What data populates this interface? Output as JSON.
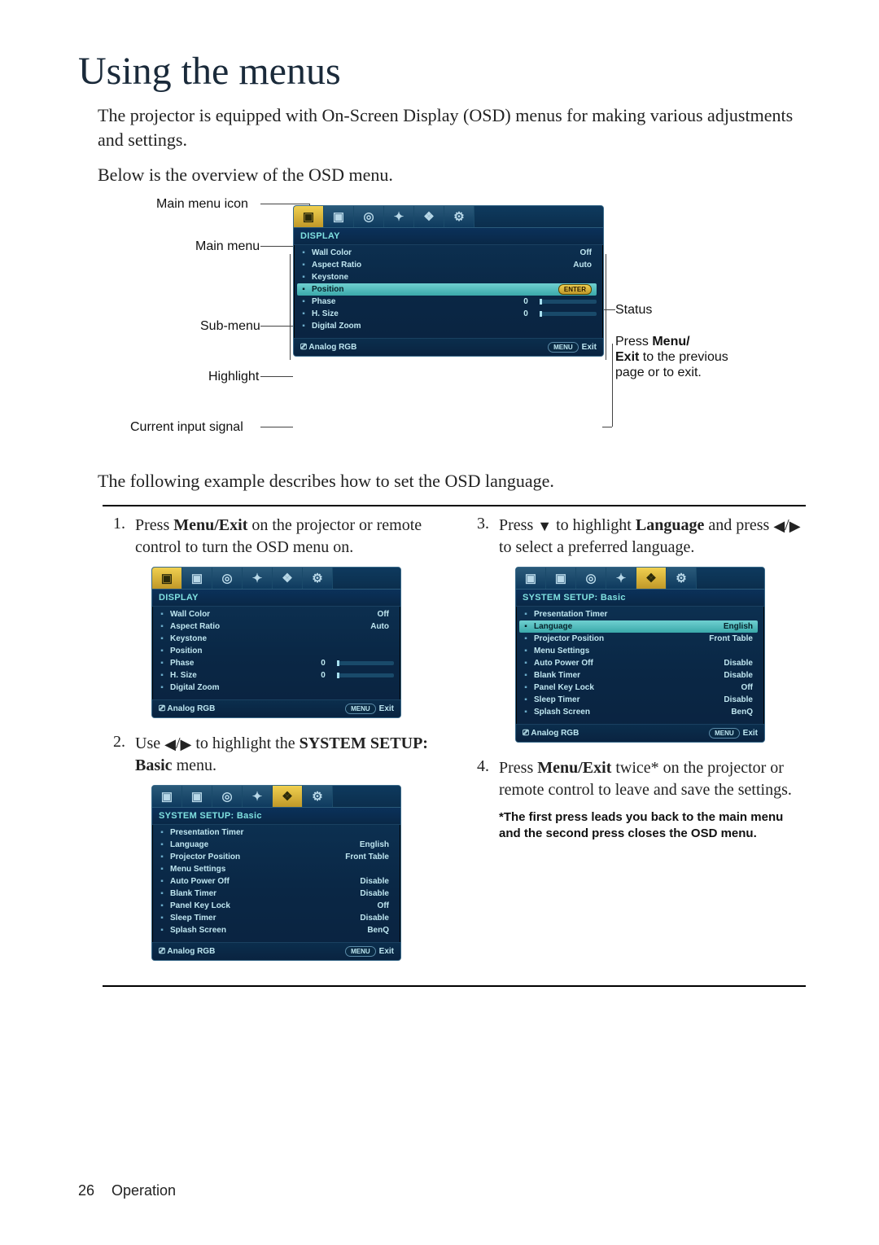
{
  "page": {
    "title": "Using the menus",
    "intro": "The projector is equipped with On-Screen Display (OSD) menus for making various adjustments and settings.",
    "below": "Below is the overview of the OSD menu.",
    "following": "The following example describes how to set the OSD language."
  },
  "diagram": {
    "main_menu_icon": "Main menu icon",
    "main_menu": "Main menu",
    "sub_menu": "Sub-menu",
    "highlight": "Highlight",
    "current_input_signal": "Current input signal",
    "status": "Status",
    "press_menu_exit": "Press Menu/\nExit to the previous page or to exit."
  },
  "osd_common": {
    "footer_input": "Analog RGB",
    "footer_menu": "MENU",
    "footer_exit": "Exit"
  },
  "display_menu": {
    "title": "DISPLAY",
    "rows": [
      {
        "label": "Wall Color",
        "value": "Off"
      },
      {
        "label": "Aspect Ratio",
        "value": "Auto"
      },
      {
        "label": "Keystone",
        "value": ""
      },
      {
        "label": "Position",
        "enter": true,
        "highlight": true
      },
      {
        "label": "Phase",
        "slider": "0"
      },
      {
        "label": "H. Size",
        "slider": "0"
      },
      {
        "label": "Digital Zoom",
        "value": ""
      }
    ]
  },
  "display_menu_small": {
    "title": "DISPLAY",
    "rows": [
      {
        "label": "Wall Color",
        "value": "Off"
      },
      {
        "label": "Aspect Ratio",
        "value": "Auto"
      },
      {
        "label": "Keystone",
        "value": ""
      },
      {
        "label": "Position",
        "value": ""
      },
      {
        "label": "Phase",
        "slider": "0"
      },
      {
        "label": "H. Size",
        "slider": "0"
      },
      {
        "label": "Digital Zoom",
        "value": ""
      }
    ]
  },
  "system_menu": {
    "title": "SYSTEM SETUP: Basic",
    "rows": [
      {
        "label": "Presentation Timer",
        "value": ""
      },
      {
        "label": "Language",
        "value": "English"
      },
      {
        "label": "Projector Position",
        "value": "Front Table"
      },
      {
        "label": "Menu Settings",
        "value": ""
      },
      {
        "label": "Auto Power Off",
        "value": "Disable"
      },
      {
        "label": "Blank Timer",
        "value": "Disable"
      },
      {
        "label": "Panel Key Lock",
        "value": "Off"
      },
      {
        "label": "Sleep Timer",
        "value": "Disable"
      },
      {
        "label": "Splash Screen",
        "value": "BenQ"
      }
    ]
  },
  "system_menu_highlight": {
    "title": "SYSTEM SETUP: Basic",
    "rows": [
      {
        "label": "Presentation Timer",
        "value": ""
      },
      {
        "label": "Language",
        "value": "English",
        "highlight": true
      },
      {
        "label": "Projector Position",
        "value": "Front Table"
      },
      {
        "label": "Menu Settings",
        "value": ""
      },
      {
        "label": "Auto Power Off",
        "value": "Disable"
      },
      {
        "label": "Blank Timer",
        "value": "Disable"
      },
      {
        "label": "Panel Key Lock",
        "value": "Off"
      },
      {
        "label": "Sleep Timer",
        "value": "Disable"
      },
      {
        "label": "Splash Screen",
        "value": "BenQ"
      }
    ]
  },
  "steps": {
    "s1_n": "1.",
    "s1_a": "Press ",
    "s1_b": "Menu/Exit",
    "s1_c": " on the projector or remote control to turn the OSD menu on.",
    "s2_n": "2.",
    "s2_a": "Use ",
    "s2_b": " to highlight the ",
    "s2_c": "SYSTEM SETUP: Basic",
    "s2_d": " menu.",
    "s3_n": "3.",
    "s3_a": "Press ",
    "s3_b": " to highlight ",
    "s3_c": "Language",
    "s3_d": " and press ",
    "s3_e": " to select a preferred language.",
    "s4_n": "4.",
    "s4_a": "Press ",
    "s4_b": "Menu/Exit",
    "s4_c": " twice* on the projector or remote control to leave and save the settings.",
    "note": "*The first press leads you back to the main menu and the second press closes the OSD menu."
  },
  "tab_icons": [
    "▣",
    "▣",
    "◎",
    "✦",
    "❖",
    "⚙"
  ],
  "enter_label": "ENTER",
  "footer": {
    "page": "26",
    "section": "Operation"
  }
}
